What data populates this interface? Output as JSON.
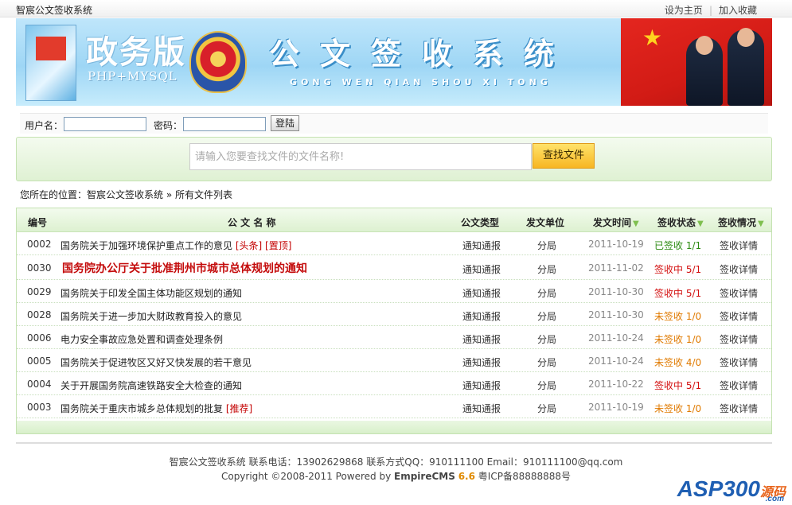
{
  "topbar": {
    "site_name": "智宸公文签收系统",
    "set_home": "设为主页",
    "add_favorite": "加入收藏",
    "separator": "|"
  },
  "banner": {
    "edition": "政务版",
    "tech": "PHP+MYSQL",
    "title": "公文签收系统",
    "pinyin": "GONG WEN QIAN SHOU XI TONG"
  },
  "login": {
    "username_label": "用户名：",
    "password_label": "密码：",
    "username_value": "",
    "password_value": "",
    "submit_label": "登陆"
  },
  "search": {
    "placeholder": "请输入您要查找文件的文件名称!",
    "button_label": "查找文件"
  },
  "breadcrumb": {
    "prefix": "您所在的位置：",
    "home": "智宸公文签收系统",
    "sep": " » ",
    "current": "所有文件列表"
  },
  "table": {
    "headers": {
      "id": "编号",
      "name": "公 文 名 称",
      "type": "公文类型",
      "unit": "发文单位",
      "date": "发文时间",
      "status": "签收状态",
      "detail": "签收情况"
    },
    "rows": [
      {
        "id": "0002",
        "name": "国务院关于加强环境保护重点工作的意见",
        "tags": "[头条] [置顶]",
        "type": "通知通报",
        "unit": "分局",
        "date": "2011-10-19",
        "status": "已签收 1/1",
        "detail": "签收详情"
      },
      {
        "id": "0030",
        "name": "国务院办公厅关于批准荆州市城市总体规划的通知",
        "tags": "",
        "type": "通知通报",
        "unit": "分局",
        "date": "2011-11-02",
        "status": "签收中 5/1",
        "detail": "签收详情"
      },
      {
        "id": "0029",
        "name": "国务院关于印发全国主体功能区规划的通知",
        "tags": "",
        "type": "通知通报",
        "unit": "分局",
        "date": "2011-10-30",
        "status": "签收中 5/1",
        "detail": "签收详情"
      },
      {
        "id": "0028",
        "name": "国务院关于进一步加大财政教育投入的意见",
        "tags": "",
        "type": "通知通报",
        "unit": "分局",
        "date": "2011-10-30",
        "status": "未签收 1/0",
        "detail": "签收详情"
      },
      {
        "id": "0006",
        "name": "电力安全事故应急处置和调查处理条例",
        "tags": "",
        "type": "通知通报",
        "unit": "分局",
        "date": "2011-10-24",
        "status": "未签收 1/0",
        "detail": "签收详情"
      },
      {
        "id": "0005",
        "name": "国务院关于促进牧区又好又快发展的若干意见",
        "tags": "",
        "type": "通知通报",
        "unit": "分局",
        "date": "2011-10-24",
        "status": "未签收 4/0",
        "detail": "签收详情"
      },
      {
        "id": "0004",
        "name": "关于开展国务院高速铁路安全大检查的通知",
        "tags": "",
        "type": "通知通报",
        "unit": "分局",
        "date": "2011-10-22",
        "status": "签收中 5/1",
        "detail": "签收详情"
      },
      {
        "id": "0003",
        "name": "国务院关于重庆市城乡总体规划的批复",
        "tags": "[推荐]",
        "type": "通知通报",
        "unit": "分局",
        "date": "2011-10-19",
        "status": "未签收 1/0",
        "detail": "签收详情"
      }
    ]
  },
  "footer": {
    "line1": "智宸公文签收系统 联系电话：13902629868 联系方式QQ：910111100 Email：910111100@qq.com",
    "copyright_prefix": "Copyright ©2008-2011 Powered by ",
    "brand": "EmpireCMS",
    "version": "6.6",
    "icp": " 粤ICP备88888888号"
  },
  "watermark": {
    "asp": "ASP",
    "num": "300",
    "src": "源码",
    "com": ".com"
  },
  "colors": {
    "status_done": "#2e8b13",
    "status_in_progress": "#d30f0f",
    "status_pending": "#e07a00",
    "tag_red": "#c30000",
    "panel_green_border": "#c4e2b1",
    "search_button": "#f7b623"
  }
}
